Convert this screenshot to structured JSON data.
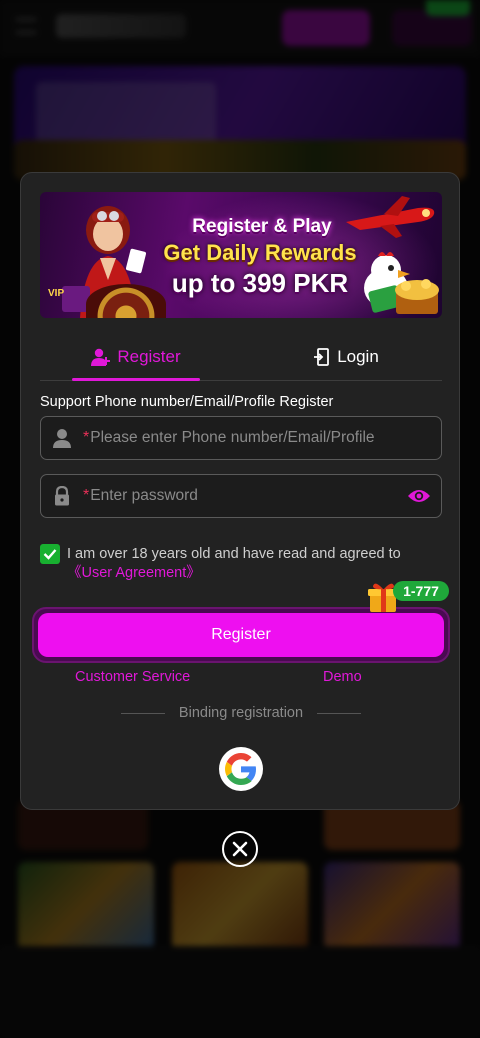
{
  "promo": {
    "line1": "Register & Play",
    "line2": "Get Daily Rewards",
    "line3": "up to 399 PKR",
    "vip_label": "VIP"
  },
  "tabs": [
    {
      "label": "Register",
      "icon": "user-add-icon",
      "active": true
    },
    {
      "label": "Login",
      "icon": "login-icon",
      "active": false
    }
  ],
  "form": {
    "support_text": "Support Phone number/Email/Profile Register",
    "required_mark": "*",
    "phone_placeholder": "Please enter Phone number/Email/Profile",
    "password_placeholder": "Enter password",
    "agree_text": "I am over 18 years old and have read and agreed to ",
    "agree_link": "《User Agreement》",
    "agree_checked": true,
    "bonus_badge": "1-777",
    "register_button": "Register",
    "customer_service": "Customer Service",
    "demo": "Demo",
    "binding_label": "Binding registration"
  },
  "colors": {
    "accent": "#e018d8",
    "button": "#ee0ff0",
    "check": "#18b030",
    "badge": "#1fa83a",
    "modal_bg": "#222222"
  }
}
